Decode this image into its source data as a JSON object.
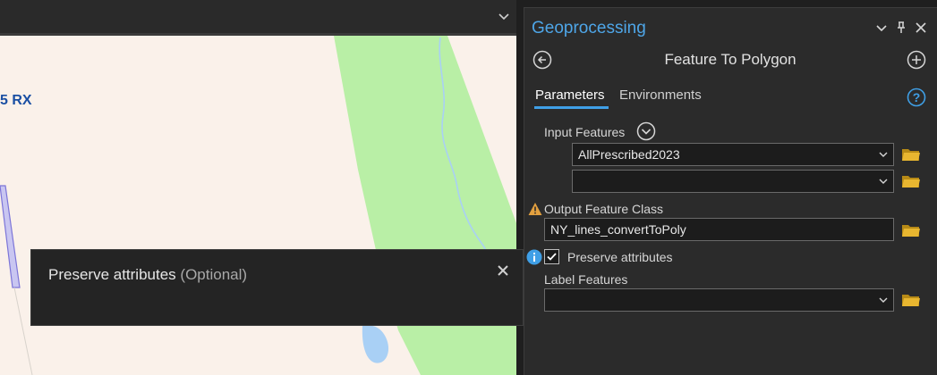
{
  "map": {
    "label": "5 RX"
  },
  "tooltip": {
    "title": "Preserve attributes",
    "optional": "(Optional)"
  },
  "pane": {
    "title": "Geoprocessing",
    "tool_name": "Feature To Polygon",
    "tabs": [
      "Parameters",
      "Environments"
    ],
    "input_features_label": "Input Features",
    "input_features_values": [
      "AllPrescribed2023",
      ""
    ],
    "output_label": "Output Feature Class",
    "output_value": "NY_lines_convertToPoly",
    "preserve_label": "Preserve attributes",
    "preserve_checked": true,
    "label_features_label": "Label Features",
    "label_features_value": ""
  },
  "colors": {
    "accent": "#4ea6e8",
    "warning": "#e2a03f",
    "folder": "#e8b630",
    "map_background": "#faf1ea",
    "map_green": "#b9efa6",
    "map_water": "#a9d0f5"
  },
  "icons": [
    "chevron-down-icon",
    "pin-icon",
    "close-icon",
    "back-arrow-icon",
    "add-icon",
    "help-icon",
    "folder-icon",
    "warning-icon",
    "info-icon",
    "checkmark-icon"
  ]
}
